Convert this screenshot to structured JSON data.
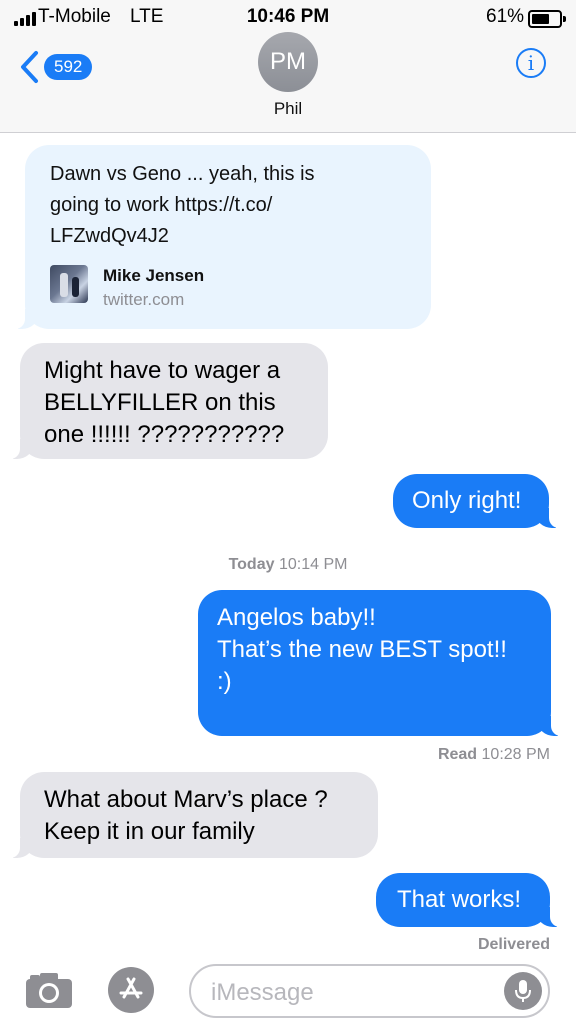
{
  "status_bar": {
    "carrier": "T-Mobile",
    "network": "LTE",
    "time": "10:46 PM",
    "battery": "61%",
    "battery_level": 0.61
  },
  "header": {
    "back_count": "592",
    "avatar_initials": "PM",
    "contact_name": "Phil",
    "info_icon": "info-icon"
  },
  "messages": [
    {
      "side": "received",
      "text": "Dawn vs Geno ... yeah, this is\ngoing to work https://t.co/\nLFZwdQv4J2",
      "link_preview": {
        "title": "Mike Jensen",
        "domain": "twitter.com"
      }
    },
    {
      "side": "received",
      "text": "Might have to wager a\nBELLYFILLER on this\none !!!!!!  ???????????"
    },
    {
      "side": "sent",
      "text": "Only right!"
    },
    {
      "side": "sent",
      "text": "Angelos baby!!\nThat’s the new BEST spot!!\n:)"
    },
    {
      "side": "received",
      "text": "What about Marv’s place ?\nKeep it in our family"
    },
    {
      "side": "sent",
      "text": "That works!"
    }
  ],
  "timestamps": {
    "divider_day": "Today",
    "divider_time": "10:14 PM",
    "read_label": "Read",
    "read_time": "10:28 PM",
    "delivered": "Delivered"
  },
  "input": {
    "placeholder": "iMessage",
    "camera_icon": "camera-icon",
    "app_store_icon": "app-store-icon",
    "mic_icon": "microphone-icon"
  },
  "colors": {
    "accent": "#1a7cf6",
    "received_bubble": "#e5e5ea",
    "link_bubble": "#e9f4fe",
    "meta_text": "#8e8e93"
  }
}
